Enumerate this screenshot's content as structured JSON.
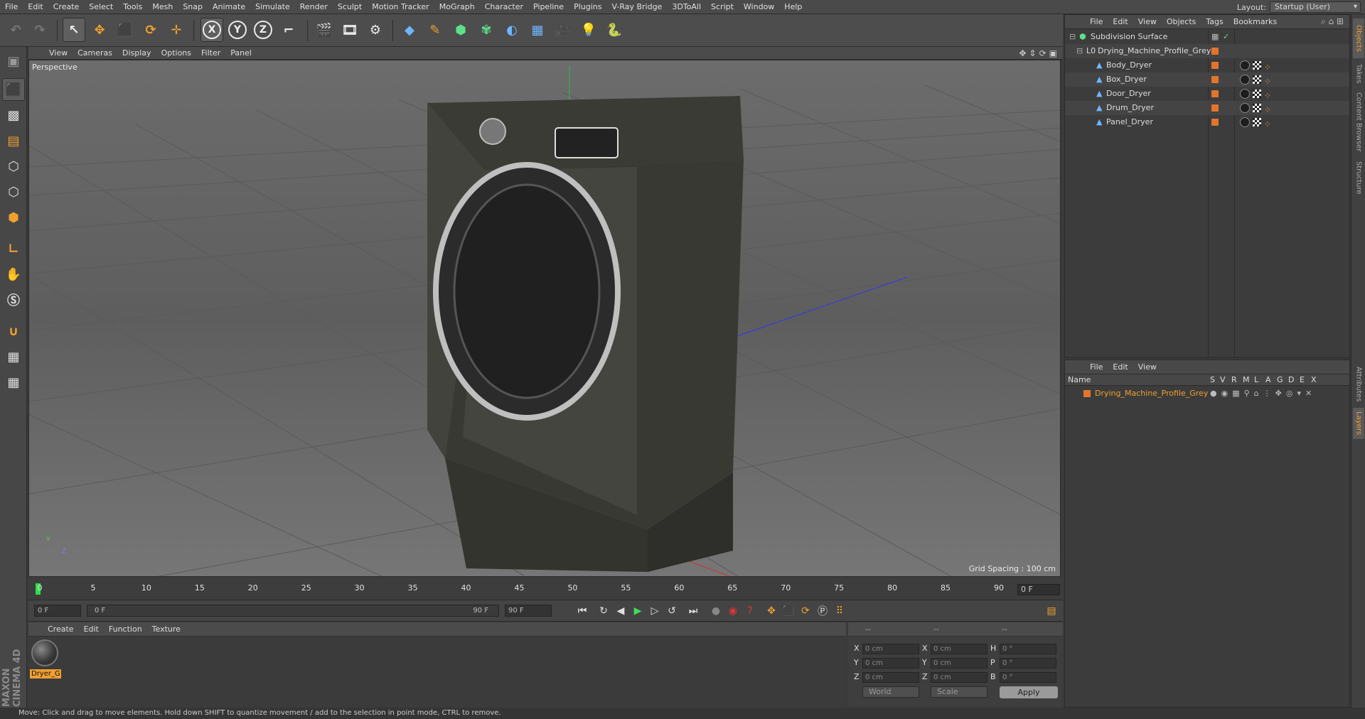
{
  "menubar": {
    "items": [
      "File",
      "Edit",
      "Create",
      "Select",
      "Tools",
      "Mesh",
      "Snap",
      "Animate",
      "Simulate",
      "Render",
      "Sculpt",
      "Motion Tracker",
      "MoGraph",
      "Character",
      "Pipeline",
      "Plugins",
      "V-Ray Bridge",
      "3DToAll",
      "Script",
      "Window",
      "Help"
    ],
    "layout_label": "Layout:",
    "layout_value": "Startup (User)"
  },
  "toolbar": {
    "undo_icon": "undo-icon",
    "redo_icon": "redo-icon",
    "axis_x": "X",
    "axis_y": "Y",
    "axis_z": "Z"
  },
  "viewport": {
    "menu": [
      "View",
      "Cameras",
      "Display",
      "Options",
      "Filter",
      "Panel"
    ],
    "camera_label": "Perspective",
    "grid_spacing": "Grid Spacing : 100 cm",
    "axis_y_label": "Y",
    "axis_z_label": "Z"
  },
  "timeline": {
    "ticks": [
      "0",
      "5",
      "10",
      "15",
      "20",
      "25",
      "30",
      "35",
      "40",
      "45",
      "50",
      "55",
      "60",
      "65",
      "70",
      "75",
      "80",
      "85",
      "90"
    ],
    "current_frame": "0 F",
    "start": "0 F",
    "range_start": "0 F",
    "range_end": "90 F",
    "end": "90 F"
  },
  "material_manager": {
    "menu": [
      "Create",
      "Edit",
      "Function",
      "Texture"
    ],
    "materials": [
      {
        "name": "Dryer_G"
      }
    ]
  },
  "coordinates": {
    "header": [
      "--",
      "--",
      "--"
    ],
    "rows": [
      {
        "axis": "X",
        "pos": "0 cm",
        "size_axis": "X",
        "size": "0 cm",
        "rot_axis": "H",
        "rot": "0 °"
      },
      {
        "axis": "Y",
        "pos": "0 cm",
        "size_axis": "Y",
        "size": "0 cm",
        "rot_axis": "P",
        "rot": "0 °"
      },
      {
        "axis": "Z",
        "pos": "0 cm",
        "size_axis": "Z",
        "size": "0 cm",
        "rot_axis": "B",
        "rot": "0 °"
      }
    ],
    "mode": "World",
    "transform": "Scale",
    "apply": "Apply"
  },
  "object_manager": {
    "menu": [
      "File",
      "Edit",
      "View",
      "Objects",
      "Tags",
      "Bookmarks"
    ],
    "objects": [
      {
        "name": "Subdivision Surface",
        "level": 0
      },
      {
        "name": "Drying_Machine_Profile_Grey",
        "level": 1
      },
      {
        "name": "Body_Dryer",
        "level": 2
      },
      {
        "name": "Box_Dryer",
        "level": 2
      },
      {
        "name": "Door_Dryer",
        "level": 2
      },
      {
        "name": "Drum_Dryer",
        "level": 2
      },
      {
        "name": "Panel_Dryer",
        "level": 2
      }
    ]
  },
  "layer_manager": {
    "menu": [
      "File",
      "Edit",
      "View"
    ],
    "columns": [
      "Name",
      "S",
      "V",
      "R",
      "M",
      "L",
      "A",
      "G",
      "D",
      "E",
      "X"
    ],
    "layers": [
      {
        "name": "Drying_Machine_Profile_Grey",
        "color": "#e2752b"
      }
    ]
  },
  "right_tabs": [
    "Objects",
    "Takes",
    "Content Browser",
    "Structure",
    "Attributes",
    "Layers"
  ],
  "status": "Move: Click and drag to move elements. Hold down SHIFT to quantize movement / add to the selection in point mode, CTRL to remove.",
  "brand": {
    "maxon": "MAXON",
    "product": "CINEMA 4D"
  },
  "colors": {
    "accent": "#f0a030",
    "layer_orange": "#e2752b",
    "playhead": "#2de048"
  }
}
